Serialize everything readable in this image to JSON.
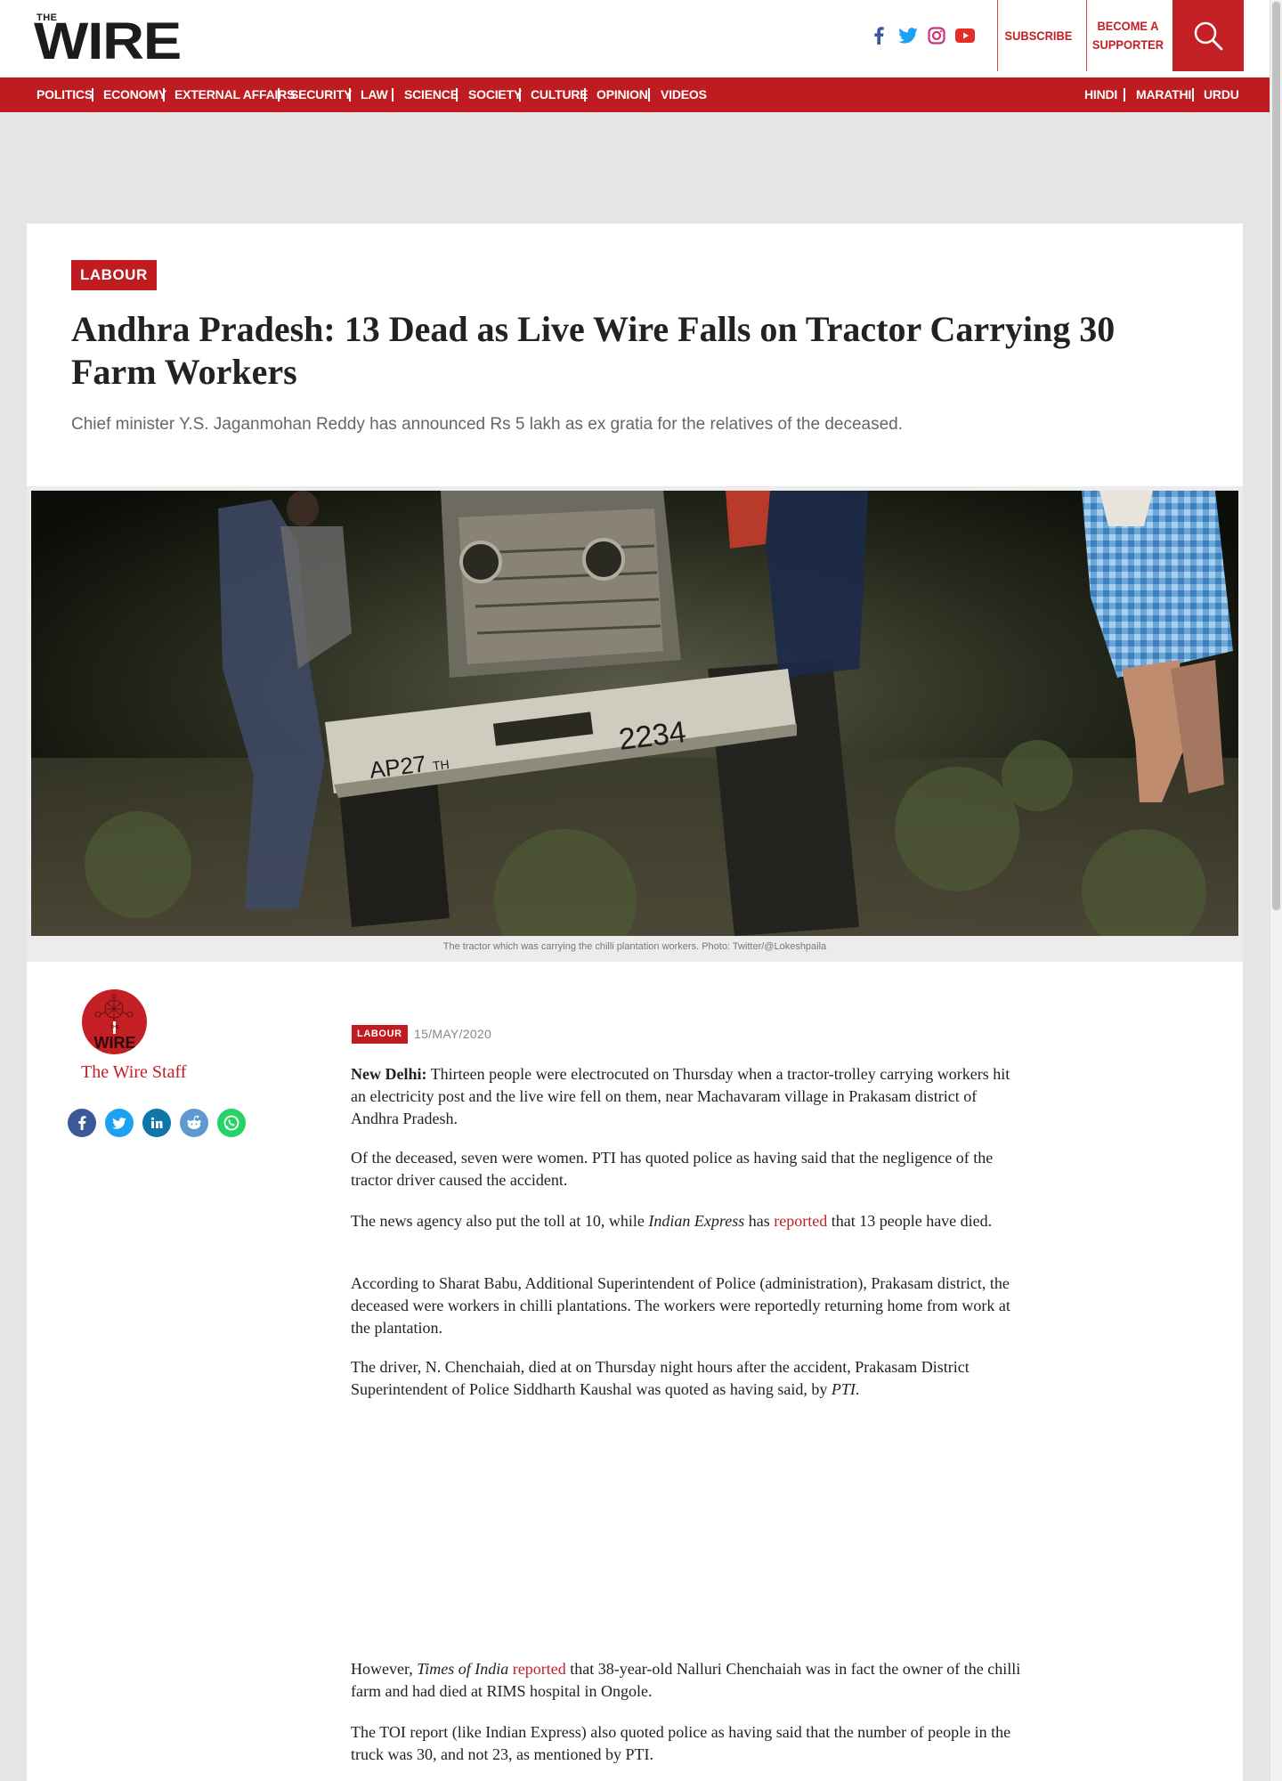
{
  "header": {
    "logo_small": "THE",
    "logo_big": "WIRE",
    "subscribe": "SUBSCRIBE",
    "supporter_line1": "BECOME A",
    "supporter_line2": "SUPPORTER",
    "social_icons": [
      "facebook-icon",
      "twitter-icon",
      "instagram-icon",
      "youtube-icon"
    ],
    "accent_color": "#bf1c22"
  },
  "nav": {
    "items": [
      "POLITICS",
      "ECONOMY",
      "EXTERNAL AFFAIRS",
      "SECURITY",
      "LAW",
      "SCIENCE",
      "SOCIETY",
      "CULTURE",
      "OPINION",
      "VIDEOS"
    ],
    "languages": [
      "HINDI",
      "MARATHI",
      "URDU"
    ]
  },
  "article": {
    "category": "LABOUR",
    "title": "Andhra Pradesh: 13 Dead as Live Wire Falls on Tractor Carrying 30 Farm Workers",
    "dek": "Chief minister Y.S. Jaganmohan Reddy has announced Rs 5 lakh as ex gratia for the relatives of the deceased.",
    "caption": "The tractor which was carrying the chilli plantation workers. Photo: Twitter/@Lokeshpaila",
    "plate_left": "AP27",
    "plate_sub": "TH",
    "plate_right": "2234",
    "author": "The Wire Staff",
    "avatar_text": "WIRE",
    "avatar_small": "THE",
    "meta_tag": "LABOUR",
    "date": "15/MAY/2020",
    "share_icons": [
      "facebook-icon",
      "twitter-icon",
      "linkedin-icon",
      "reddit-icon",
      "whatsapp-icon"
    ],
    "p1_lead": "New Delhi:",
    "p1_text": " Thirteen people were electrocuted on Thursday when a tractor-trolley carrying workers hit an electricity post and the live wire fell on them, near Machavaram village in Prakasam district of Andhra Pradesh.",
    "p2": "Of the deceased, seven were women. PTI has quoted police as having said that the negligence of the tractor driver caused the accident.",
    "p3_a": "The news agency also put the toll at 10, while ",
    "p3_i": "Indian Express",
    "p3_b": " has ",
    "p3_link": "reported",
    "p3_c": " that 13 people have died.",
    "p4": "According to Sharat Babu, Additional Superintendent of Police (administration), Prakasam district, the deceased were workers in chilli plantations. The workers were reportedly returning home from work at the plantation.",
    "p5_a": "The driver, N. Chenchaiah, died at on Thursday night hours after the accident, Prakasam District Superintendent of Police Siddharth Kaushal was quoted as having said, by ",
    "p5_i": "PTI",
    "p5_b": ".",
    "p6_a": "However, ",
    "p6_i": "Times of India",
    "p6_b": " ",
    "p6_link": "reported",
    "p6_c": " that 38-year-old Nalluri Chenchaiah was in fact the owner of the chilli farm and had died at RIMS hospital in Ongole.",
    "p7": "The TOI report (like Indian Express) also quoted police as having said that the number of people in the truck was 30, and not 23, as mentioned by PTI."
  }
}
